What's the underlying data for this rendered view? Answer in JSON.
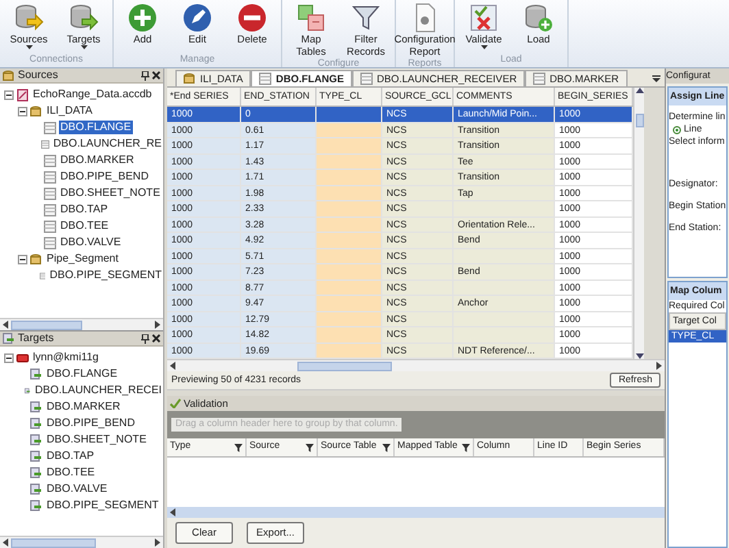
{
  "ribbon": {
    "groups": [
      {
        "label": "Connections",
        "buttons": [
          {
            "label": "Sources",
            "kind": "sources",
            "dropdown": true
          },
          {
            "label": "Targets",
            "kind": "targets",
            "dropdown": true
          }
        ]
      },
      {
        "label": "Manage",
        "buttons": [
          {
            "label": "Add",
            "kind": "add",
            "dropdown": false
          },
          {
            "label": "Edit",
            "kind": "edit",
            "dropdown": false
          },
          {
            "label": "Delete",
            "kind": "delete",
            "dropdown": false
          }
        ]
      },
      {
        "label": "Configure",
        "buttons": [
          {
            "label": "Map Tables",
            "kind": "map",
            "dropdown": false
          },
          {
            "label": "Filter Records",
            "kind": "filter",
            "dropdown": false
          }
        ]
      },
      {
        "label": "Reports",
        "buttons": [
          {
            "label": "Configuration Report",
            "kind": "report",
            "dropdown": false
          }
        ]
      },
      {
        "label": "Load",
        "buttons": [
          {
            "label": "Validate",
            "kind": "validate",
            "dropdown": true
          },
          {
            "label": "Load",
            "kind": "load",
            "dropdown": false
          }
        ]
      }
    ]
  },
  "sources": {
    "title": "Sources",
    "tree": [
      {
        "label": "EchoRange_Data.accdb",
        "kind": "file",
        "expanded": true,
        "selected": false,
        "children": [
          {
            "label": "ILI_DATA",
            "kind": "schema",
            "expanded": true,
            "selected": false,
            "children": [
              {
                "label": "DBO.FLANGE",
                "kind": "table",
                "selected": true
              },
              {
                "label": "DBO.LAUNCHER_RE",
                "kind": "table",
                "selected": false
              },
              {
                "label": "DBO.MARKER",
                "kind": "table",
                "selected": false
              },
              {
                "label": "DBO.PIPE_BEND",
                "kind": "table",
                "selected": false
              },
              {
                "label": "DBO.SHEET_NOTE",
                "kind": "table",
                "selected": false
              },
              {
                "label": "DBO.TAP",
                "kind": "table",
                "selected": false
              },
              {
                "label": "DBO.TEE",
                "kind": "table",
                "selected": false
              },
              {
                "label": "DBO.VALVE",
                "kind": "table",
                "selected": false
              }
            ]
          },
          {
            "label": "Pipe_Segment",
            "kind": "schema",
            "expanded": true,
            "selected": false,
            "children": [
              {
                "label": "DBO.PIPE_SEGMENT",
                "kind": "table",
                "selected": false
              }
            ]
          }
        ]
      }
    ]
  },
  "targets": {
    "title": "Targets",
    "tree": [
      {
        "label": "lynn@kmi11g",
        "kind": "server",
        "expanded": true,
        "selected": false,
        "children": [
          {
            "label": "DBO.FLANGE",
            "kind": "target",
            "selected": false
          },
          {
            "label": "DBO.LAUNCHER_RECEI",
            "kind": "target",
            "selected": false
          },
          {
            "label": "DBO.MARKER",
            "kind": "target",
            "selected": false
          },
          {
            "label": "DBO.PIPE_BEND",
            "kind": "target",
            "selected": false
          },
          {
            "label": "DBO.SHEET_NOTE",
            "kind": "target",
            "selected": false
          },
          {
            "label": "DBO.TAP",
            "kind": "target",
            "selected": false
          },
          {
            "label": "DBO.TEE",
            "kind": "target",
            "selected": false
          },
          {
            "label": "DBO.VALVE",
            "kind": "target",
            "selected": false
          },
          {
            "label": "DBO.PIPE_SEGMENT",
            "kind": "target",
            "selected": false
          }
        ]
      }
    ]
  },
  "grid": {
    "tabs": [
      {
        "label": "ILI_DATA",
        "kind": "schema",
        "selected": false
      },
      {
        "label": "DBO.FLANGE",
        "kind": "table",
        "selected": true
      },
      {
        "label": "DBO.LAUNCHER_RECEIVER",
        "kind": "table",
        "selected": false
      },
      {
        "label": "DBO.MARKER",
        "kind": "table",
        "selected": false
      }
    ],
    "columns": [
      {
        "label": "*End SERIES",
        "color": "#dbe6f2"
      },
      {
        "label": "END_STATION",
        "color": "#dbe6f2"
      },
      {
        "label": "TYPE_CL",
        "color": "#fde0b2"
      },
      {
        "label": "SOURCE_GCL",
        "color": "#ecebd9"
      },
      {
        "label": "COMMENTS",
        "color": "#ecebd9"
      },
      {
        "label": "BEGIN_SERIES",
        "color": "#ffffff"
      }
    ],
    "rows": [
      {
        "selected": true,
        "cells": [
          "1000",
          "0",
          "",
          "NCS",
          "Launch/Mid Poin...",
          "1000"
        ]
      },
      {
        "selected": false,
        "cells": [
          "1000",
          "0.61",
          "",
          "NCS",
          "Transition",
          "1000"
        ]
      },
      {
        "selected": false,
        "cells": [
          "1000",
          "1.17",
          "",
          "NCS",
          "Transition",
          "1000"
        ]
      },
      {
        "selected": false,
        "cells": [
          "1000",
          "1.43",
          "",
          "NCS",
          "Tee",
          "1000"
        ]
      },
      {
        "selected": false,
        "cells": [
          "1000",
          "1.71",
          "",
          "NCS",
          "Transition",
          "1000"
        ]
      },
      {
        "selected": false,
        "cells": [
          "1000",
          "1.98",
          "",
          "NCS",
          "Tap",
          "1000"
        ]
      },
      {
        "selected": false,
        "cells": [
          "1000",
          "2.33",
          "",
          "NCS",
          "",
          "1000"
        ]
      },
      {
        "selected": false,
        "cells": [
          "1000",
          "3.28",
          "",
          "NCS",
          "Orientation Rele...",
          "1000"
        ]
      },
      {
        "selected": false,
        "cells": [
          "1000",
          "4.92",
          "",
          "NCS",
          "Bend",
          "1000"
        ]
      },
      {
        "selected": false,
        "cells": [
          "1000",
          "5.71",
          "",
          "NCS",
          "",
          "1000"
        ]
      },
      {
        "selected": false,
        "cells": [
          "1000",
          "7.23",
          "",
          "NCS",
          "Bend",
          "1000"
        ]
      },
      {
        "selected": false,
        "cells": [
          "1000",
          "8.77",
          "",
          "NCS",
          "",
          "1000"
        ]
      },
      {
        "selected": false,
        "cells": [
          "1000",
          "9.47",
          "",
          "NCS",
          "Anchor",
          "1000"
        ]
      },
      {
        "selected": false,
        "cells": [
          "1000",
          "12.79",
          "",
          "NCS",
          "",
          "1000"
        ]
      },
      {
        "selected": false,
        "cells": [
          "1000",
          "14.82",
          "",
          "NCS",
          "",
          "1000"
        ]
      },
      {
        "selected": false,
        "cells": [
          "1000",
          "19.69",
          "",
          "NCS",
          "NDT Reference/...",
          "1000"
        ]
      }
    ],
    "status": "Previewing 50 of 4231 records",
    "refresh": "Refresh"
  },
  "validation": {
    "title": "Validation",
    "group_hint": "Drag a column header here to group by that column.",
    "columns": [
      {
        "label": "Type",
        "filter": true
      },
      {
        "label": "Source",
        "filter": true
      },
      {
        "label": "Source Table",
        "filter": true
      },
      {
        "label": "Mapped Table",
        "filter": true
      },
      {
        "label": "Column",
        "filter": false
      },
      {
        "label": "Line ID",
        "filter": false
      },
      {
        "label": "Begin Series",
        "filter": false
      }
    ],
    "buttons": [
      "Clear",
      "Export..."
    ]
  },
  "config": {
    "title": "Configurat",
    "assign": {
      "title": "Assign Line",
      "prompt": "Determine lin",
      "radio": {
        "label": "Line",
        "selected": true
      },
      "select": "Select inform",
      "fields": [
        "Designator:",
        "Begin Station",
        "End Station:"
      ]
    },
    "map": {
      "title": "Map Colum",
      "required": "Required Col",
      "header": "Target Col",
      "items": [
        {
          "label": "TYPE_CL",
          "selected": true
        }
      ]
    }
  }
}
